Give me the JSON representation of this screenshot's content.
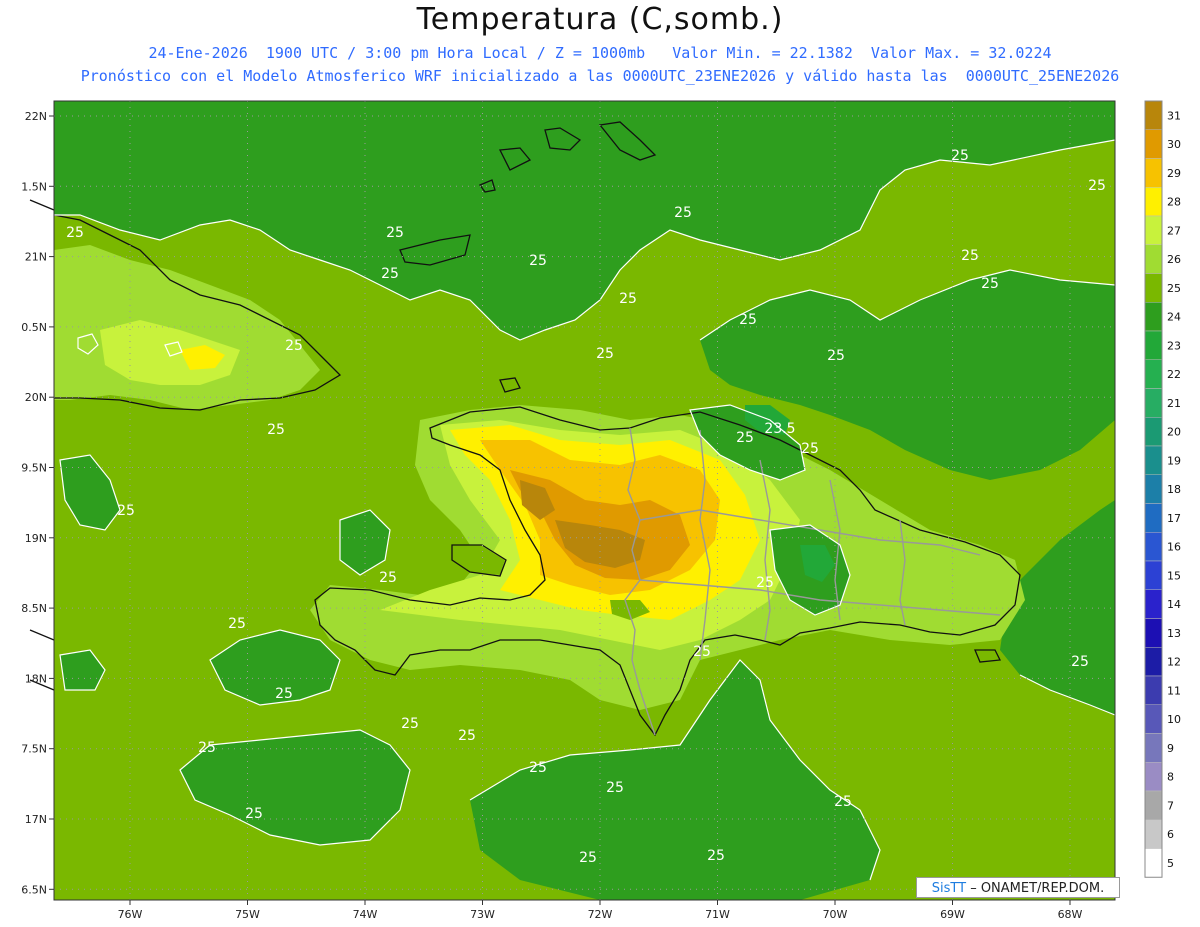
{
  "header": {
    "title": "Temperatura (C,somb.)",
    "line1": "24-Ene-2026  1900 UTC / 3:00 pm Hora Local / Z = 1000mb   Valor Min. = 22.1382  Valor Max. = 32.0224",
    "line2": "Pronóstico con el Modelo Atmosferico WRF inicializado a las 0000UTC_23ENE2026 y válido hasta las  0000UTC_25ENE2026"
  },
  "axes": {
    "lat_labels": [
      "22N",
      "1.5N",
      "21N",
      "0.5N",
      "20N",
      "9.5N",
      "19N",
      "8.5N",
      "18N",
      "7.5N",
      "17N",
      "6.5N"
    ],
    "lon_labels": [
      "76W",
      "75W",
      "74W",
      "73W",
      "72W",
      "71W",
      "70W",
      "69W",
      "68W"
    ]
  },
  "colorbar": {
    "levels": [
      "31",
      "30",
      "29",
      "28",
      "27",
      "26",
      "25",
      "24",
      "23",
      "22",
      "21",
      "20",
      "19",
      "18",
      "17",
      "16",
      "15",
      "14",
      "13",
      "12",
      "11",
      "10",
      "9",
      "8",
      "7",
      "6",
      "5"
    ],
    "colors": [
      "#b8860b",
      "#e09a00",
      "#f7c200",
      "#fff000",
      "#c8f23c",
      "#a0dc32",
      "#7ab800",
      "#2e9e1e",
      "#22a838",
      "#25b050",
      "#27ad63",
      "#1b9a73",
      "#1a8f8d",
      "#1c7fa8",
      "#1f6cc2",
      "#2a56d2",
      "#2c41d4",
      "#2a22cc",
      "#1c0fb3",
      "#1c1ca6",
      "#3c3caf",
      "#5858b8",
      "#7777bb",
      "#9a8cc4",
      "#a8a8a8",
      "#c8c8c8",
      "#ffffff"
    ]
  },
  "contour_labels": [
    "25",
    "23.5"
  ],
  "logo": {
    "brand": "SisTT",
    "text": " – ONAMET/REP.DOM."
  },
  "colors": {
    "background_field": "#7ab800",
    "sea_cool": "#2e9e1e",
    "subtitle": "#2f6bff"
  }
}
